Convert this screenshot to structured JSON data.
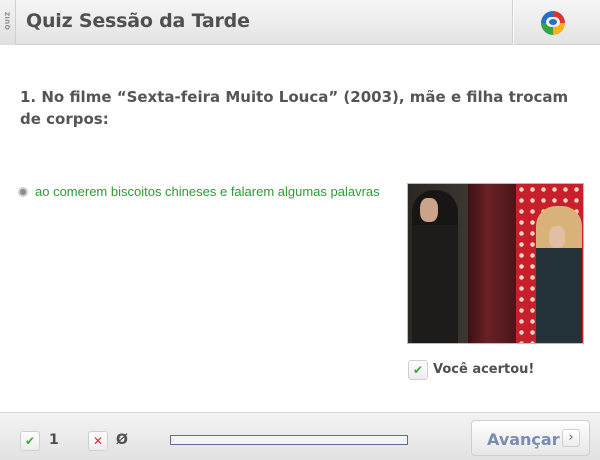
{
  "header": {
    "tab_label": "QUIZ",
    "title": "Quiz Sessão da Tarde",
    "logo": "globo-logo-icon"
  },
  "question": {
    "text": "1. No filme “Sexta-feira Muito Louca” (2003), mãe e filha trocam de corpos:"
  },
  "answer": {
    "text": "ao comerem biscoitos chineses e falarem algumas palavras",
    "color": "#2a9d36"
  },
  "feedback": {
    "icon": "check-icon",
    "text": "Você acertou!"
  },
  "footer": {
    "correct_icon": "check-icon",
    "correct_count": "1",
    "wrong_icon": "x-icon",
    "wrong_count": "Ø",
    "progress_fraction": 0.0,
    "next_label": "Avançar",
    "next_icon": "chevron-right-icon"
  },
  "colors": {
    "correct": "#2a9d36",
    "wrong": "#d23434",
    "accent": "#7b8cb3"
  }
}
